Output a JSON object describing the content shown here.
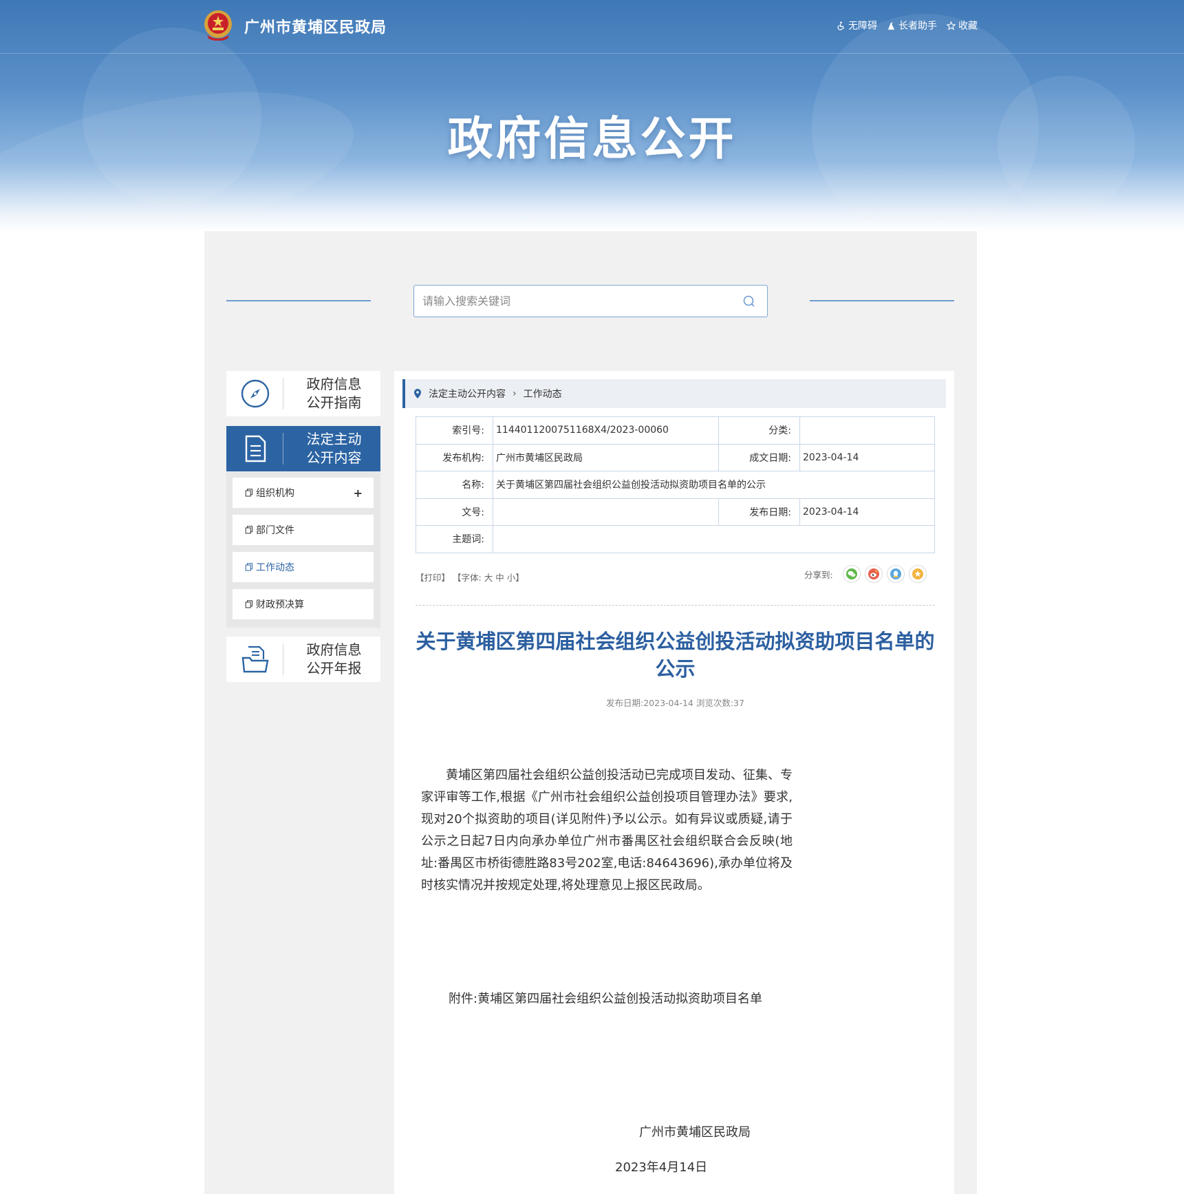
{
  "header": {
    "site_name": "广州市黄埔区民政局",
    "links": [
      "无障碍",
      "长者助手",
      "收藏"
    ]
  },
  "banner": {
    "title": "政府信息公开"
  },
  "search": {
    "placeholder": "请输入搜索关键词"
  },
  "sidebar": {
    "cards": [
      {
        "label_line1": "政府信息",
        "label_line2": "公开指南",
        "icon": "compass-icon"
      },
      {
        "label_line1": "法定主动",
        "label_line2": "公开内容",
        "icon": "document-icon",
        "active": true
      },
      {
        "label_line1": "政府信息",
        "label_line2": "公开年报",
        "icon": "report-icon"
      }
    ],
    "sub_items": [
      {
        "label": "组织机构",
        "expand": "+"
      },
      {
        "label": "部门文件"
      },
      {
        "label": "工作动态",
        "current": true
      },
      {
        "label": "财政预决算"
      }
    ]
  },
  "breadcrumb": {
    "items": [
      "法定主动公开内容",
      "工作动态"
    ],
    "separator": "›"
  },
  "meta": {
    "index_label": "索引号:",
    "index_value": "1144011200751168X4/2023-00060",
    "category_label": "分类:",
    "category_value": "",
    "publisher_label": "发布机构:",
    "publisher_value": "广州市黄埔区民政局",
    "date_written_label": "成文日期:",
    "date_written_value": "2023-04-14",
    "name_label": "名称:",
    "name_value": "关于黄埔区第四届社会组织公益创投活动拟资助项目名单的公示",
    "doc_no_label": "文号:",
    "doc_no_value": "",
    "publish_date_label": "发布日期:",
    "publish_date_value": "2023-04-14",
    "subject_label": "主题词:",
    "subject_value": ""
  },
  "tools": {
    "print": "【打印】",
    "font_label": "【字体:",
    "font_large": "大",
    "font_medium": "中",
    "font_small": "小",
    "font_close": "】",
    "share_label": "分享到:"
  },
  "article": {
    "title": "关于黄埔区第四届社会组织公益创投活动拟资助项目名单的公示",
    "info": "发布日期:2023-04-14 浏览次数:37",
    "body": "黄埔区第四届社会组织公益创投活动已完成项目发动、征集、专家评审等工作,根据《广州市社会组织公益创投项目管理办法》要求,现对20个拟资助的项目(详见附件)予以公示。如有异议或质疑,请于公示之日起7日内向承办单位广州市番禺区社会组织联合会反映(地址:番禺区市桥街德胜路83号202室,电话:84643696),承办单位将及时核实情况并按规定处理,将处理意见上报区民政局。",
    "attachment": "附件:黄埔区第四届社会组织公益创投活动拟资助项目名单",
    "sign_org": "广州市黄埔区民政局",
    "sign_date": "2023年4月14日"
  },
  "colors": {
    "brand_blue": "#2c64a3",
    "title_blue": "#2c5fa0",
    "panel_gray": "#f1f1f1"
  }
}
